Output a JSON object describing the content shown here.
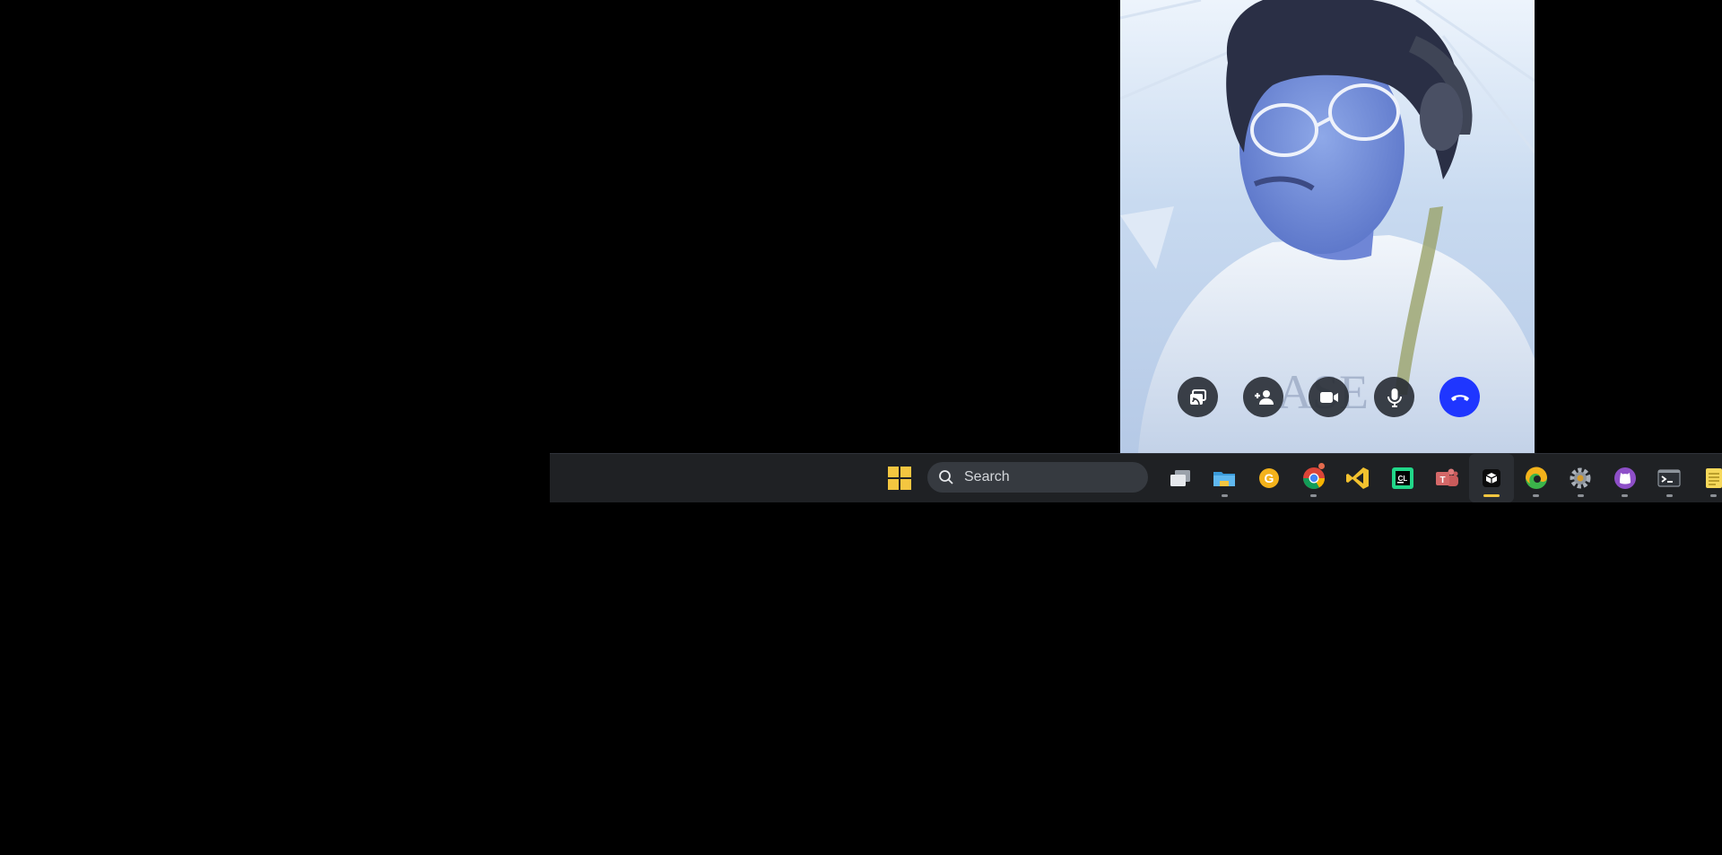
{
  "video_call": {
    "controls": [
      {
        "name": "share-screen-button",
        "icon": "screen-share-icon"
      },
      {
        "name": "add-participant-button",
        "icon": "add-person-icon"
      },
      {
        "name": "camera-button",
        "icon": "video-camera-icon"
      },
      {
        "name": "microphone-button",
        "icon": "microphone-icon"
      },
      {
        "name": "hang-up-button",
        "icon": "phone-hangup-icon",
        "color": "#1f36ff"
      }
    ]
  },
  "taskbar": {
    "search": {
      "placeholder": "Search"
    },
    "apps": [
      {
        "name": "task-view",
        "icon": "task-view-icon",
        "indicator": false,
        "active": false
      },
      {
        "name": "file-explorer",
        "icon": "folder-icon",
        "indicator": true,
        "active": false
      },
      {
        "name": "grammarly",
        "icon": "grammarly-icon",
        "indicator": false,
        "active": false
      },
      {
        "name": "google-chrome",
        "icon": "chrome-icon",
        "indicator": true,
        "active": false
      },
      {
        "name": "visual-studio-code",
        "icon": "vscode-icon",
        "indicator": false,
        "active": false
      },
      {
        "name": "clion",
        "icon": "clion-icon",
        "indicator": false,
        "active": false
      },
      {
        "name": "microsoft-teams",
        "icon": "teams-icon",
        "indicator": false,
        "active": false
      },
      {
        "name": "active-app",
        "icon": "app-cube-icon",
        "indicator": true,
        "active": true
      },
      {
        "name": "microsoft-edge",
        "icon": "edge-icon",
        "indicator": true,
        "active": false
      },
      {
        "name": "settings",
        "icon": "gear-icon",
        "indicator": true,
        "active": false
      },
      {
        "name": "github-desktop",
        "icon": "github-icon",
        "indicator": true,
        "active": false
      },
      {
        "name": "terminal",
        "icon": "terminal-icon",
        "indicator": true,
        "active": false
      },
      {
        "name": "notepad",
        "icon": "notepad-icon",
        "indicator": true,
        "active": false
      }
    ],
    "accent_color": "#f4c640"
  }
}
